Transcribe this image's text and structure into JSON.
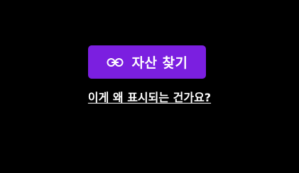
{
  "find_asset_button": {
    "label": "자산 찾기",
    "icon": "link-icon"
  },
  "help_link": {
    "text": "이게 왜 표시되는 건가요?"
  },
  "colors": {
    "background": "#000000",
    "button": "#7b1fe0",
    "text": "#ffffff"
  }
}
